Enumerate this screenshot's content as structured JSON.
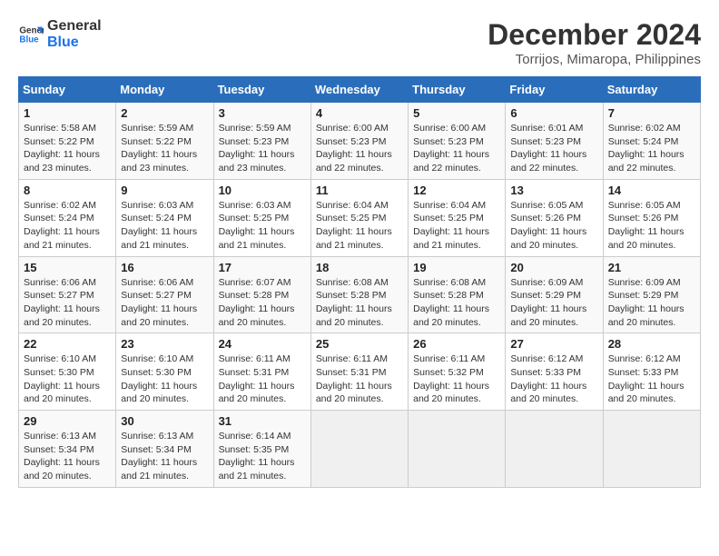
{
  "logo": {
    "line1": "General",
    "line2": "Blue"
  },
  "title": "December 2024",
  "subtitle": "Torrijos, Mimaropa, Philippines",
  "days_of_week": [
    "Sunday",
    "Monday",
    "Tuesday",
    "Wednesday",
    "Thursday",
    "Friday",
    "Saturday"
  ],
  "weeks": [
    [
      {
        "day": "1",
        "content": "Sunrise: 5:58 AM\nSunset: 5:22 PM\nDaylight: 11 hours\nand 23 minutes."
      },
      {
        "day": "2",
        "content": "Sunrise: 5:59 AM\nSunset: 5:22 PM\nDaylight: 11 hours\nand 23 minutes."
      },
      {
        "day": "3",
        "content": "Sunrise: 5:59 AM\nSunset: 5:23 PM\nDaylight: 11 hours\nand 23 minutes."
      },
      {
        "day": "4",
        "content": "Sunrise: 6:00 AM\nSunset: 5:23 PM\nDaylight: 11 hours\nand 22 minutes."
      },
      {
        "day": "5",
        "content": "Sunrise: 6:00 AM\nSunset: 5:23 PM\nDaylight: 11 hours\nand 22 minutes."
      },
      {
        "day": "6",
        "content": "Sunrise: 6:01 AM\nSunset: 5:23 PM\nDaylight: 11 hours\nand 22 minutes."
      },
      {
        "day": "7",
        "content": "Sunrise: 6:02 AM\nSunset: 5:24 PM\nDaylight: 11 hours\nand 22 minutes."
      }
    ],
    [
      {
        "day": "8",
        "content": "Sunrise: 6:02 AM\nSunset: 5:24 PM\nDaylight: 11 hours\nand 21 minutes."
      },
      {
        "day": "9",
        "content": "Sunrise: 6:03 AM\nSunset: 5:24 PM\nDaylight: 11 hours\nand 21 minutes."
      },
      {
        "day": "10",
        "content": "Sunrise: 6:03 AM\nSunset: 5:25 PM\nDaylight: 11 hours\nand 21 minutes."
      },
      {
        "day": "11",
        "content": "Sunrise: 6:04 AM\nSunset: 5:25 PM\nDaylight: 11 hours\nand 21 minutes."
      },
      {
        "day": "12",
        "content": "Sunrise: 6:04 AM\nSunset: 5:25 PM\nDaylight: 11 hours\nand 21 minutes."
      },
      {
        "day": "13",
        "content": "Sunrise: 6:05 AM\nSunset: 5:26 PM\nDaylight: 11 hours\nand 20 minutes."
      },
      {
        "day": "14",
        "content": "Sunrise: 6:05 AM\nSunset: 5:26 PM\nDaylight: 11 hours\nand 20 minutes."
      }
    ],
    [
      {
        "day": "15",
        "content": "Sunrise: 6:06 AM\nSunset: 5:27 PM\nDaylight: 11 hours\nand 20 minutes."
      },
      {
        "day": "16",
        "content": "Sunrise: 6:06 AM\nSunset: 5:27 PM\nDaylight: 11 hours\nand 20 minutes."
      },
      {
        "day": "17",
        "content": "Sunrise: 6:07 AM\nSunset: 5:28 PM\nDaylight: 11 hours\nand 20 minutes."
      },
      {
        "day": "18",
        "content": "Sunrise: 6:08 AM\nSunset: 5:28 PM\nDaylight: 11 hours\nand 20 minutes."
      },
      {
        "day": "19",
        "content": "Sunrise: 6:08 AM\nSunset: 5:28 PM\nDaylight: 11 hours\nand 20 minutes."
      },
      {
        "day": "20",
        "content": "Sunrise: 6:09 AM\nSunset: 5:29 PM\nDaylight: 11 hours\nand 20 minutes."
      },
      {
        "day": "21",
        "content": "Sunrise: 6:09 AM\nSunset: 5:29 PM\nDaylight: 11 hours\nand 20 minutes."
      }
    ],
    [
      {
        "day": "22",
        "content": "Sunrise: 6:10 AM\nSunset: 5:30 PM\nDaylight: 11 hours\nand 20 minutes."
      },
      {
        "day": "23",
        "content": "Sunrise: 6:10 AM\nSunset: 5:30 PM\nDaylight: 11 hours\nand 20 minutes."
      },
      {
        "day": "24",
        "content": "Sunrise: 6:11 AM\nSunset: 5:31 PM\nDaylight: 11 hours\nand 20 minutes."
      },
      {
        "day": "25",
        "content": "Sunrise: 6:11 AM\nSunset: 5:31 PM\nDaylight: 11 hours\nand 20 minutes."
      },
      {
        "day": "26",
        "content": "Sunrise: 6:11 AM\nSunset: 5:32 PM\nDaylight: 11 hours\nand 20 minutes."
      },
      {
        "day": "27",
        "content": "Sunrise: 6:12 AM\nSunset: 5:33 PM\nDaylight: 11 hours\nand 20 minutes."
      },
      {
        "day": "28",
        "content": "Sunrise: 6:12 AM\nSunset: 5:33 PM\nDaylight: 11 hours\nand 20 minutes."
      }
    ],
    [
      {
        "day": "29",
        "content": "Sunrise: 6:13 AM\nSunset: 5:34 PM\nDaylight: 11 hours\nand 20 minutes."
      },
      {
        "day": "30",
        "content": "Sunrise: 6:13 AM\nSunset: 5:34 PM\nDaylight: 11 hours\nand 21 minutes."
      },
      {
        "day": "31",
        "content": "Sunrise: 6:14 AM\nSunset: 5:35 PM\nDaylight: 11 hours\nand 21 minutes."
      },
      {
        "day": "",
        "content": ""
      },
      {
        "day": "",
        "content": ""
      },
      {
        "day": "",
        "content": ""
      },
      {
        "day": "",
        "content": ""
      }
    ]
  ]
}
